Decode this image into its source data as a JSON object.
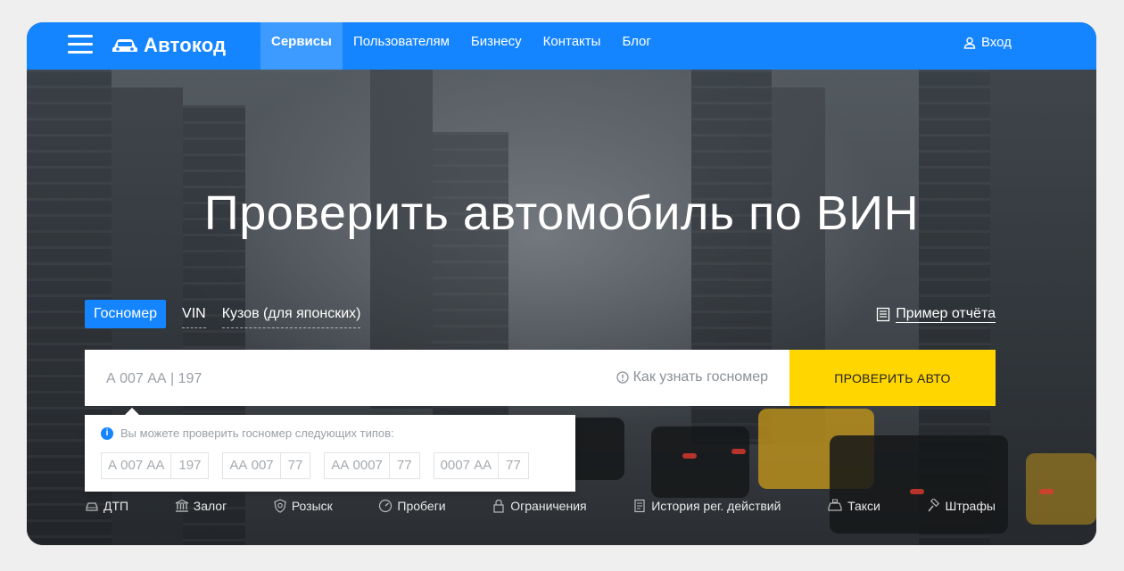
{
  "header": {
    "brand": "Автокод",
    "nav": [
      {
        "label": "Сервисы",
        "active": true
      },
      {
        "label": "Пользователям"
      },
      {
        "label": "Бизнесу"
      },
      {
        "label": "Контакты"
      },
      {
        "label": "Блог"
      }
    ],
    "login_label": "Вход",
    "bg_color": "#1585ff"
  },
  "hero": {
    "title": "Проверить автомобиль по ВИН"
  },
  "tabs": [
    {
      "label": "Госномер",
      "active": true
    },
    {
      "label": "VIN"
    },
    {
      "label": "Кузов (для японских)"
    }
  ],
  "sample_report_label": "Пример отчёта",
  "search": {
    "placeholder": "А 007 АА | 197",
    "help_label": "Как узнать госномер",
    "submit_label": "ПРОВЕРИТЬ АВТО",
    "submit_color": "#ffd600"
  },
  "hint": {
    "title": "Вы можете проверить госномер следующих типов:",
    "plates": [
      {
        "number": "А 007 АА",
        "region": "197"
      },
      {
        "number": "АА 007",
        "region": "77"
      },
      {
        "number": "АА 0007",
        "region": "77"
      },
      {
        "number": "0007 АА",
        "region": "77"
      }
    ]
  },
  "services": [
    {
      "label": "ДТП",
      "icon": "car-crash-icon"
    },
    {
      "label": "Залог",
      "icon": "bank-icon"
    },
    {
      "label": "Розыск",
      "icon": "badge-icon"
    },
    {
      "label": "Пробеги",
      "icon": "speedometer-icon"
    },
    {
      "label": "Ограничения",
      "icon": "lock-icon"
    },
    {
      "label": "История рег. действий",
      "icon": "document-icon"
    },
    {
      "label": "Такси",
      "icon": "taxi-icon"
    },
    {
      "label": "Штрафы",
      "icon": "gavel-icon"
    }
  ]
}
